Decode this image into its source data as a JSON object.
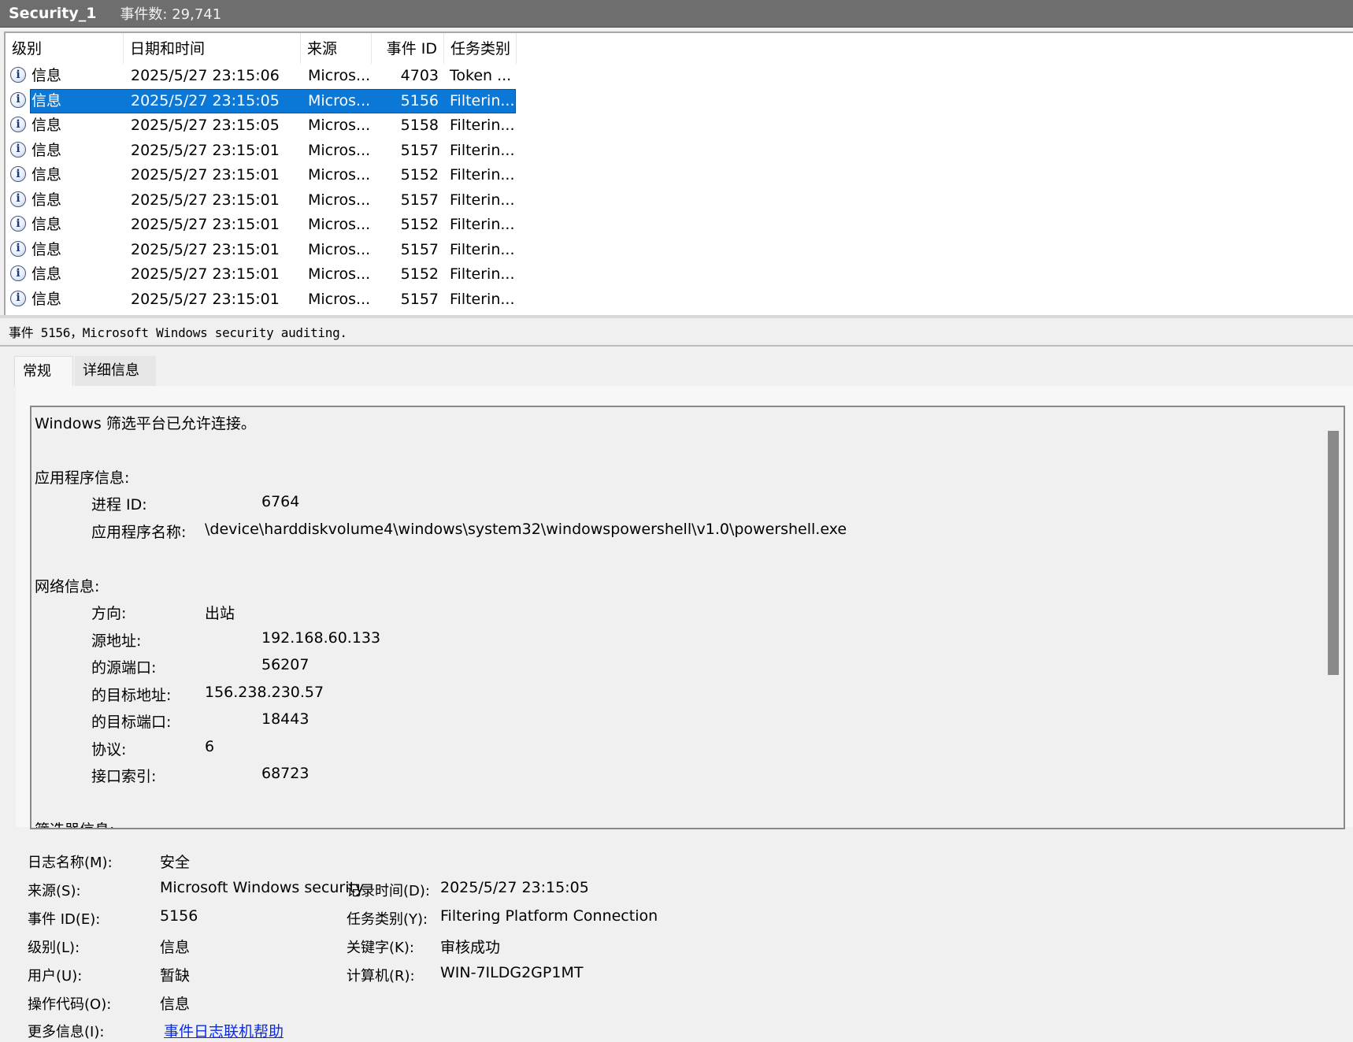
{
  "window": {
    "title": "Security_1",
    "event_count": "事件数: 29,741"
  },
  "grid": {
    "columns": [
      "级别",
      "日期和时间",
      "来源",
      "事件 ID",
      "任务类别"
    ],
    "rows": [
      {
        "level": "信息",
        "date": "2025/5/27 23:15:06",
        "source": "Micros...",
        "id": "4703",
        "task": "Token ...",
        "selected": false
      },
      {
        "level": "信息",
        "date": "2025/5/27 23:15:05",
        "source": "Micros...",
        "id": "5156",
        "task": "Filterin...",
        "selected": true
      },
      {
        "level": "信息",
        "date": "2025/5/27 23:15:05",
        "source": "Micros...",
        "id": "5158",
        "task": "Filterin...",
        "selected": false
      },
      {
        "level": "信息",
        "date": "2025/5/27 23:15:01",
        "source": "Micros...",
        "id": "5157",
        "task": "Filterin...",
        "selected": false
      },
      {
        "level": "信息",
        "date": "2025/5/27 23:15:01",
        "source": "Micros...",
        "id": "5152",
        "task": "Filterin...",
        "selected": false
      },
      {
        "level": "信息",
        "date": "2025/5/27 23:15:01",
        "source": "Micros...",
        "id": "5157",
        "task": "Filterin...",
        "selected": false
      },
      {
        "level": "信息",
        "date": "2025/5/27 23:15:01",
        "source": "Micros...",
        "id": "5152",
        "task": "Filterin...",
        "selected": false
      },
      {
        "level": "信息",
        "date": "2025/5/27 23:15:01",
        "source": "Micros...",
        "id": "5157",
        "task": "Filterin...",
        "selected": false
      },
      {
        "level": "信息",
        "date": "2025/5/27 23:15:01",
        "source": "Micros...",
        "id": "5152",
        "task": "Filterin...",
        "selected": false
      },
      {
        "level": "信息",
        "date": "2025/5/27 23:15:01",
        "source": "Micros...",
        "id": "5157",
        "task": "Filterin...",
        "selected": false
      }
    ]
  },
  "event_header": "事件 5156，Microsoft Windows security auditing.",
  "tabs": {
    "general": "常规",
    "details": "详细信息"
  },
  "description": {
    "intro": "Windows 筛选平台已允许连接。",
    "app_section": "应用程序信息:",
    "process_id_label": "进程 ID:",
    "process_id": "6764",
    "app_name_label": "应用程序名称:",
    "app_name": "\\device\\harddiskvolume4\\windows\\system32\\windowspowershell\\v1.0\\powershell.exe",
    "net_section": "网络信息:",
    "direction_label": "方向:",
    "direction": "出站",
    "src_addr_label": "源地址:",
    "src_addr": "192.168.60.133",
    "src_port_label": "的源端口:",
    "src_port": "56207",
    "dst_addr_label": "的目标地址:",
    "dst_addr": "156.238.230.57",
    "dst_port_label": "的目标端口:",
    "dst_port": "18443",
    "protocol_label": "协议:",
    "protocol": "6",
    "iface_label": "接口索引:",
    "iface": "68723",
    "filter_section": "筛选器信息:"
  },
  "props": {
    "log_name_label": "日志名称(M):",
    "log_name": "安全",
    "source_label": "来源(S):",
    "source": "Microsoft Windows security",
    "logged_label": "记录时间(D):",
    "logged": "2025/5/27 23:15:05",
    "event_id_label": "事件 ID(E):",
    "event_id": "5156",
    "task_label": "任务类别(Y):",
    "task": "Filtering Platform Connection",
    "level_label": "级别(L):",
    "level": "信息",
    "keywords_label": "关键字(K):",
    "keywords": "审核成功",
    "user_label": "用户(U):",
    "user": "暂缺",
    "computer_label": "计算机(R):",
    "computer": "WIN-7ILDG2GP1MT",
    "opcode_label": "操作代码(O):",
    "opcode": "信息",
    "more_info_label": "更多信息(I):",
    "more_info_link": "事件日志联机帮助"
  }
}
